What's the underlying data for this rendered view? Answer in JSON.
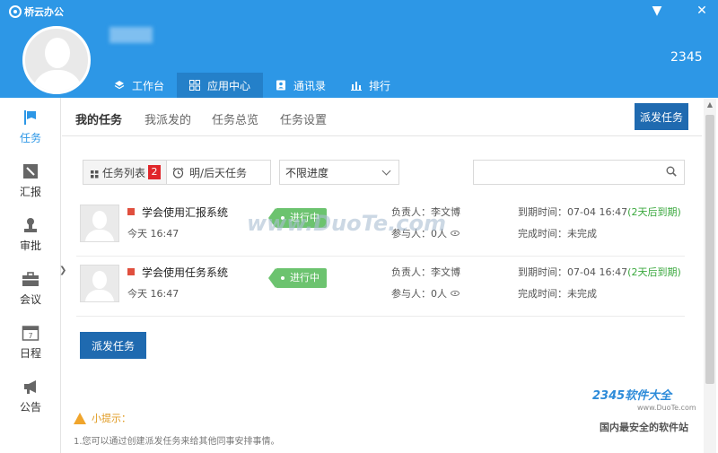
{
  "app": {
    "title": "桥云办公",
    "user_id": "2345"
  },
  "window": {
    "minimize": "▼",
    "close": "✕"
  },
  "nav": {
    "items": [
      {
        "label": "工作台",
        "icon": "layers-icon"
      },
      {
        "label": "应用中心",
        "icon": "grid-icon"
      },
      {
        "label": "通讯录",
        "icon": "contacts-icon"
      },
      {
        "label": "排行",
        "icon": "bar-chart-icon"
      }
    ],
    "active": "应用中心"
  },
  "sidebar": {
    "items": [
      {
        "label": "任务",
        "icon": "flag-icon"
      },
      {
        "label": "汇报",
        "icon": "report-icon"
      },
      {
        "label": "审批",
        "icon": "stamp-icon"
      },
      {
        "label": "会议",
        "icon": "briefcase-icon"
      },
      {
        "label": "日程",
        "icon": "calendar-icon",
        "day": "7"
      },
      {
        "label": "公告",
        "icon": "megaphone-icon"
      }
    ],
    "active": "任务"
  },
  "tabs": {
    "items": [
      "我的任务",
      "我派发的",
      "任务总览",
      "任务设置"
    ],
    "active": "我的任务",
    "dispatch_label": "派发任务"
  },
  "filters": {
    "task_list_label": "任务列表",
    "task_list_count": "2",
    "upcoming_label": "明/后天任务",
    "progress_value": "不限进度",
    "search_placeholder": ""
  },
  "tasks": [
    {
      "title": "学会使用汇报系统",
      "time": "今天 16:47",
      "status": "进行中",
      "owner": "负责人：李文博",
      "members": "参与人：0人",
      "due": "到期时间：07-04 16:47",
      "due_note": "(2天后到期)",
      "completion": "完成时间：未完成"
    },
    {
      "title": "学会使用任务系统",
      "time": "今天 16:47",
      "status": "进行中",
      "owner": "负责人：李文博",
      "members": "参与人：0人",
      "due": "到期时间：07-04 16:47",
      "due_note": "(2天后到期)",
      "completion": "完成时间：未完成"
    }
  ],
  "main": {
    "dispatch_label": "派发任务"
  },
  "tip": {
    "title": "小提示：",
    "text": "1.您可以通过创建派发任务来给其他同事安排事情。"
  },
  "watermarks": {
    "center": "www.DuoTe.com",
    "brand": "2345软件大全",
    "url": "www.DuoTe.com",
    "slogan": "国内最安全的软件站"
  },
  "colors": {
    "primary": "#2d97e6",
    "nav_active": "#2480c9",
    "button": "#1f6ab0",
    "status_green": "#6cc36f",
    "alert_red": "#e0262a"
  }
}
